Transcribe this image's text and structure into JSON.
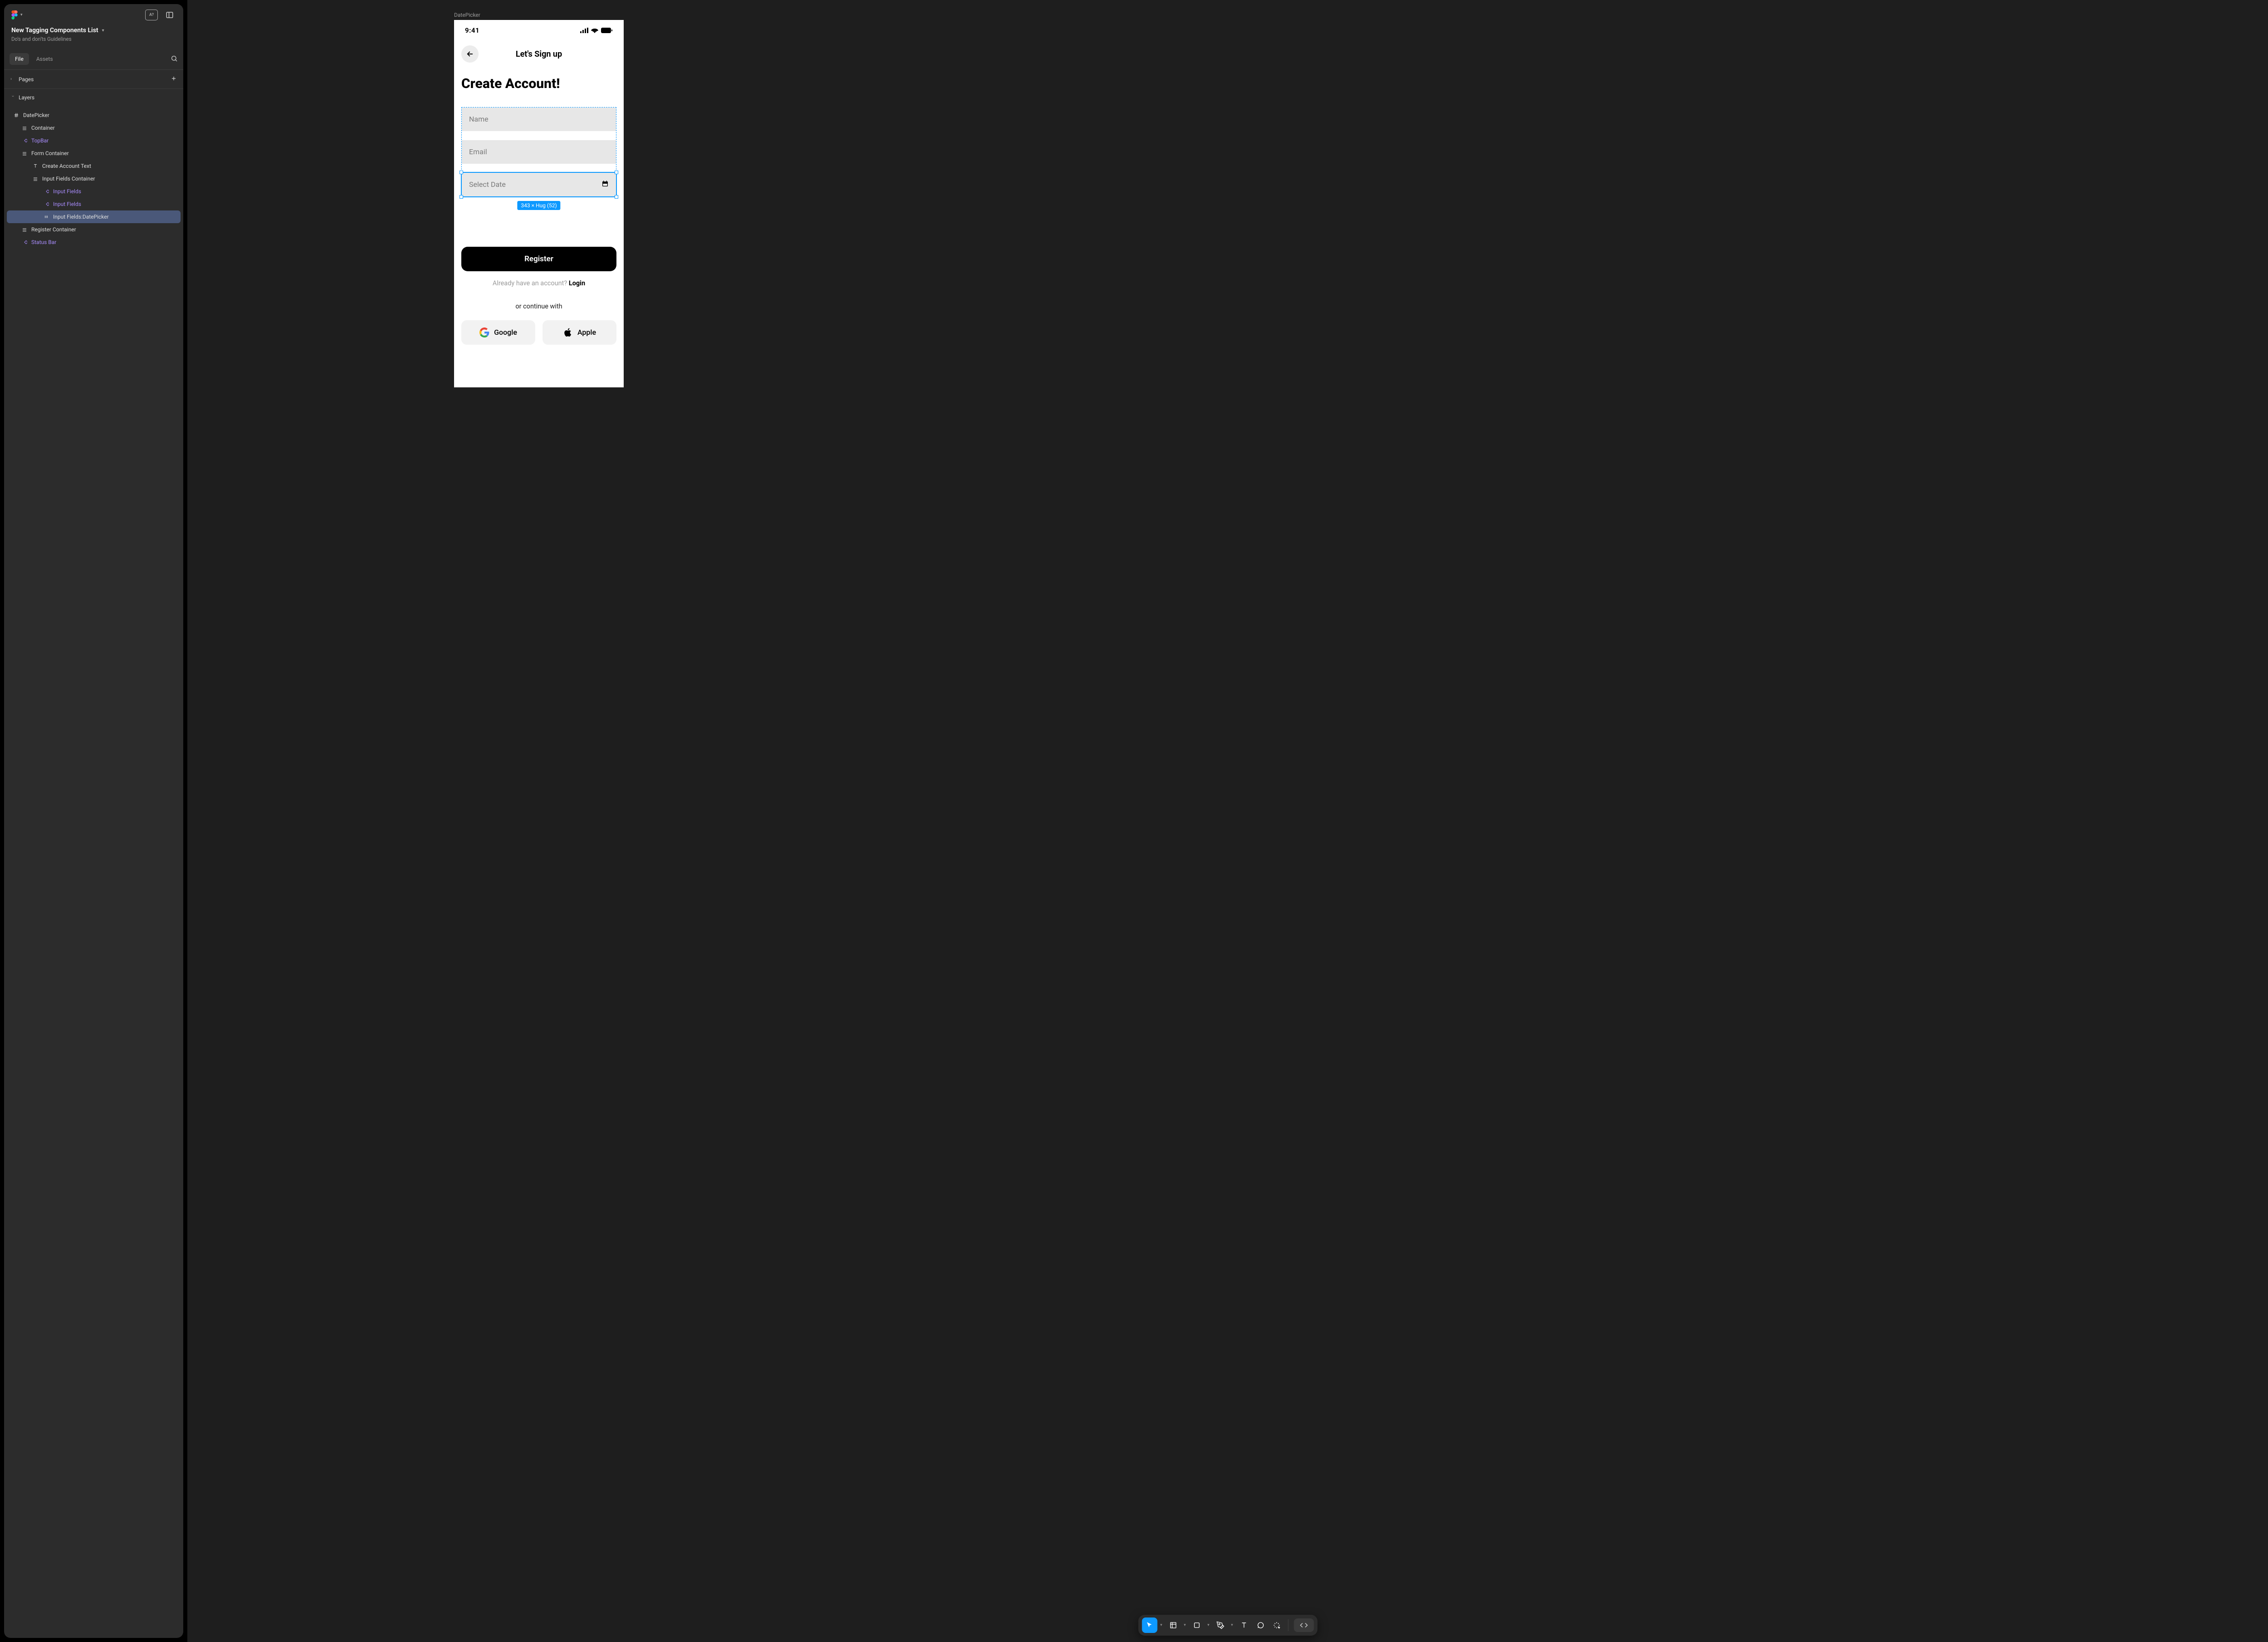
{
  "panel": {
    "file_title": "New Tagging Components List",
    "file_subtitle": "Do's and don'ts Guidelines",
    "tabs": {
      "file": "File",
      "assets": "Assets"
    },
    "pages_label": "Pages",
    "layers_label": "Layers",
    "header_badge": "A?",
    "layers": [
      {
        "label": "DatePicker",
        "depth": 0,
        "icon": "hash",
        "purple": false,
        "active": false
      },
      {
        "label": "Container",
        "depth": 1,
        "icon": "frame",
        "purple": false,
        "active": false
      },
      {
        "label": "TopBar",
        "depth": 1,
        "icon": "component",
        "purple": true,
        "active": false
      },
      {
        "label": "Form Container",
        "depth": 1,
        "icon": "frame",
        "purple": false,
        "active": false
      },
      {
        "label": "Create Account Text",
        "depth": 2,
        "icon": "text",
        "purple": false,
        "active": false
      },
      {
        "label": "Input Fields Container",
        "depth": 2,
        "icon": "frame",
        "purple": false,
        "active": false
      },
      {
        "label": "Input Fields",
        "depth": 3,
        "icon": "component",
        "purple": true,
        "active": false
      },
      {
        "label": "Input Fields",
        "depth": 3,
        "icon": "component",
        "purple": true,
        "active": false
      },
      {
        "label": "Input Fields:DatePicker",
        "depth": 3,
        "icon": "variant",
        "purple": false,
        "active": true
      },
      {
        "label": "Register Container",
        "depth": 1,
        "icon": "frame",
        "purple": false,
        "active": false
      },
      {
        "label": "Status Bar",
        "depth": 1,
        "icon": "component",
        "purple": true,
        "active": false
      }
    ]
  },
  "canvas": {
    "frame_label": "DatePicker",
    "status_time": "9:41",
    "topbar_title": "Let's Sign up",
    "create_title": "Create Account!",
    "inputs": {
      "name_placeholder": "Name",
      "email_placeholder": "Email",
      "date_placeholder": "Select Date"
    },
    "size_badge": "343 × Hug (52)",
    "register_label": "Register",
    "already_text": "Already have an account? ",
    "login_text": "Login",
    "continue_text": "or continue with",
    "google_label": "Google",
    "apple_label": "Apple"
  }
}
